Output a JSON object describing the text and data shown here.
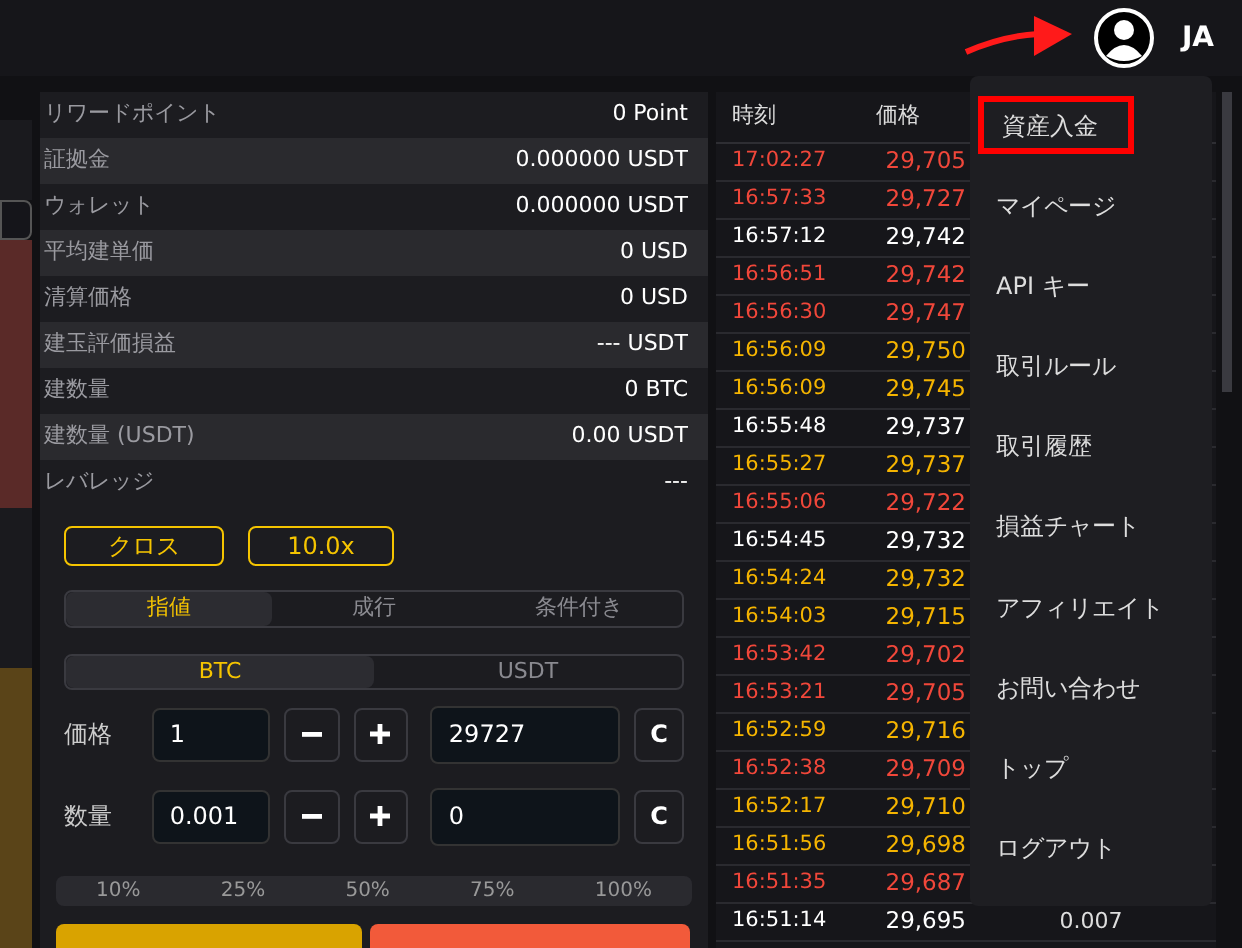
{
  "header": {
    "callout_arrow": true,
    "user_initials": "JA"
  },
  "account_info": [
    {
      "label": "リワードポイント",
      "value": "0 Point"
    },
    {
      "label": "証拠金",
      "value": "0.000000 USDT"
    },
    {
      "label": "ウォレット",
      "value": "0.000000 USDT"
    },
    {
      "label": "平均建単価",
      "value": "0 USD"
    },
    {
      "label": "清算価格",
      "value": "0 USD"
    },
    {
      "label": "建玉評価損益",
      "value": "--- USDT"
    },
    {
      "label": "建数量",
      "value": "0 BTC"
    },
    {
      "label": "建数量 (USDT)",
      "value": "0.00 USDT"
    },
    {
      "label": "レバレッジ",
      "value": "---"
    }
  ],
  "margin_mode": "クロス",
  "leverage": "10.0x",
  "order_types": [
    {
      "label": "指値",
      "selected": true
    },
    {
      "label": "成行",
      "selected": false
    },
    {
      "label": "条件付き",
      "selected": false
    }
  ],
  "units": [
    {
      "label": "BTC",
      "selected": true
    },
    {
      "label": "USDT",
      "selected": false
    }
  ],
  "inputs": [
    {
      "label": "価格",
      "step": "1",
      "value": "29727",
      "clear": "C"
    },
    {
      "label": "数量",
      "step": "0.001",
      "value": "0",
      "clear": "C"
    }
  ],
  "percentages": [
    "10%",
    "25%",
    "50%",
    "75%",
    "100%"
  ],
  "trades": {
    "columns": [
      "時刻",
      "価格"
    ],
    "rows": [
      {
        "time": "17:02:27",
        "price": "29,705",
        "color": "#f0473a"
      },
      {
        "time": "16:57:33",
        "price": "29,727",
        "color": "#f0473a"
      },
      {
        "time": "16:57:12",
        "price": "29,742",
        "color": "#ffffff"
      },
      {
        "time": "16:56:51",
        "price": "29,742",
        "color": "#f0473a"
      },
      {
        "time": "16:56:30",
        "price": "29,747",
        "color": "#f0473a"
      },
      {
        "time": "16:56:09",
        "price": "29,750",
        "color": "#f5b400"
      },
      {
        "time": "16:56:09",
        "price": "29,745",
        "color": "#f5b400"
      },
      {
        "time": "16:55:48",
        "price": "29,737",
        "color": "#ffffff"
      },
      {
        "time": "16:55:27",
        "price": "29,737",
        "color": "#f5b400"
      },
      {
        "time": "16:55:06",
        "price": "29,722",
        "color": "#f0473a"
      },
      {
        "time": "16:54:45",
        "price": "29,732",
        "color": "#ffffff"
      },
      {
        "time": "16:54:24",
        "price": "29,732",
        "color": "#f5b400"
      },
      {
        "time": "16:54:03",
        "price": "29,715",
        "color": "#f5b400"
      },
      {
        "time": "16:53:42",
        "price": "29,702",
        "color": "#f0473a"
      },
      {
        "time": "16:53:21",
        "price": "29,705",
        "color": "#f0473a"
      },
      {
        "time": "16:52:59",
        "price": "29,716",
        "color": "#f5b400"
      },
      {
        "time": "16:52:38",
        "price": "29,709",
        "color": "#f0473a"
      },
      {
        "time": "16:52:17",
        "price": "29,710",
        "color": "#f5b400"
      },
      {
        "time": "16:51:56",
        "price": "29,698",
        "color": "#f5b400"
      },
      {
        "time": "16:51:35",
        "price": "29,687",
        "color": "#f0473a"
      },
      {
        "time": "16:51:14",
        "price": "29,695",
        "color": "#ffffff",
        "amount": "0.007"
      }
    ]
  },
  "user_menu": [
    {
      "label": "資産入金",
      "highlighted": true
    },
    {
      "label": "マイページ",
      "highlighted": false
    },
    {
      "label": "API キー",
      "highlighted": false
    },
    {
      "label": "取引ルール",
      "highlighted": false
    },
    {
      "label": "取引履歴",
      "highlighted": false
    },
    {
      "label": "損益チャート",
      "highlighted": false
    },
    {
      "label": "アフィリエイト",
      "highlighted": false
    },
    {
      "label": "お問い合わせ",
      "highlighted": false
    },
    {
      "label": "トップ",
      "highlighted": false
    },
    {
      "label": "ログアウト",
      "highlighted": false
    }
  ]
}
